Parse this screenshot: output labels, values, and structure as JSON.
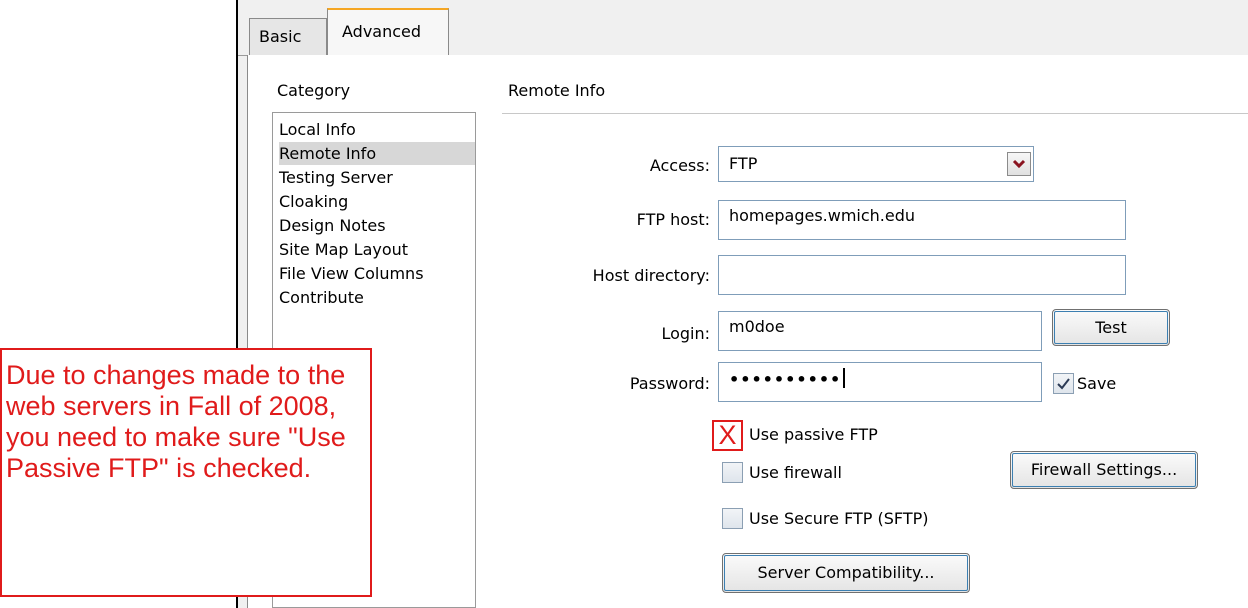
{
  "tabs": [
    {
      "label": "Basic"
    },
    {
      "label": "Advanced"
    }
  ],
  "category": {
    "title": "Category",
    "items": [
      {
        "label": "Local Info"
      },
      {
        "label": "Remote Info"
      },
      {
        "label": "Testing Server"
      },
      {
        "label": "Cloaking"
      },
      {
        "label": "Design Notes"
      },
      {
        "label": "Site Map Layout"
      },
      {
        "label": "File View Columns"
      },
      {
        "label": "Contribute"
      }
    ],
    "selected": "Remote Info"
  },
  "remote": {
    "title": "Remote Info",
    "access_label": "Access:",
    "access_value": "FTP",
    "ftp_host_label": "FTP host:",
    "ftp_host_value": "homepages.wmich.edu",
    "host_dir_label": "Host directory:",
    "host_dir_value": "",
    "login_label": "Login:",
    "login_value": "m0doe",
    "test_button": "Test",
    "password_label": "Password:",
    "password_value": "••••••••••",
    "save_label": "Save",
    "save_checked": true,
    "passive_label": "Use passive FTP",
    "passive_mark": "X",
    "firewall_label": "Use firewall",
    "firewall_settings_button": "Firewall Settings...",
    "sftp_label": "Use Secure FTP (SFTP)",
    "server_compat_button": "Server Compatibility..."
  },
  "annotation": {
    "note": "Due to changes made to the web servers in Fall of 2008, you need to make sure \"Use Passive FTP\" is checked."
  },
  "colors": {
    "annotation": "#e01b1b",
    "selected_item": "#d7d7d7",
    "tab_accent": "#f5a623"
  }
}
